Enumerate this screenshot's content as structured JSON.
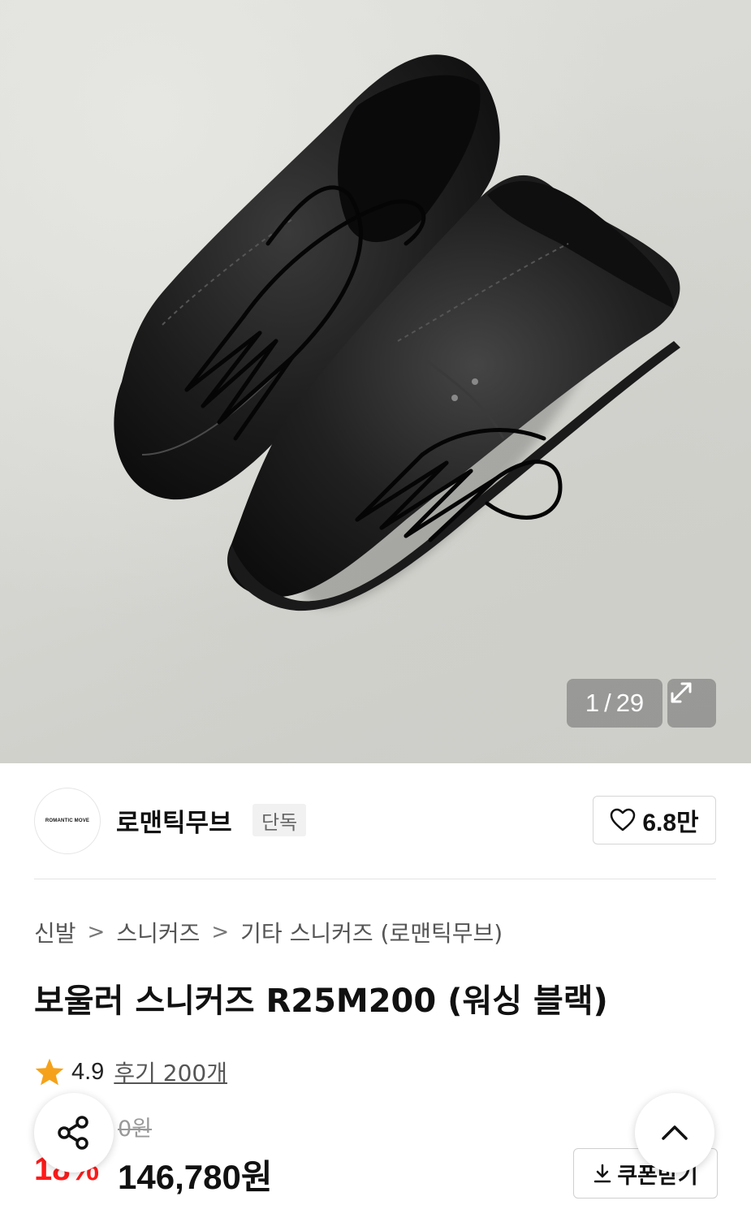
{
  "gallery": {
    "current": "1",
    "separator": "/",
    "total": "29"
  },
  "brand": {
    "logo_text": "ROMANTIC MOVE",
    "name": "로맨틱무브",
    "badge": "단독",
    "likes": "6.8만"
  },
  "breadcrumb": [
    "신발",
    "스니커즈",
    "기타 스니커즈 (로맨틱무브)"
  ],
  "product": {
    "title": "보울러 스니커즈 R25M200 (워싱 블랙)"
  },
  "rating": {
    "score": "4.9",
    "reviews": "후기 200개"
  },
  "price": {
    "original": "0원",
    "discount": "18%",
    "sale": "146,780원"
  },
  "coupon": {
    "label": "쿠폰받기"
  },
  "colors": {
    "discount": "#ff1a1a",
    "star": "#f5a21a"
  },
  "icons": [
    "expand-icon",
    "heart-icon",
    "chevron-right-icon",
    "star-icon",
    "download-icon",
    "share-icon",
    "chevron-up-icon"
  ]
}
